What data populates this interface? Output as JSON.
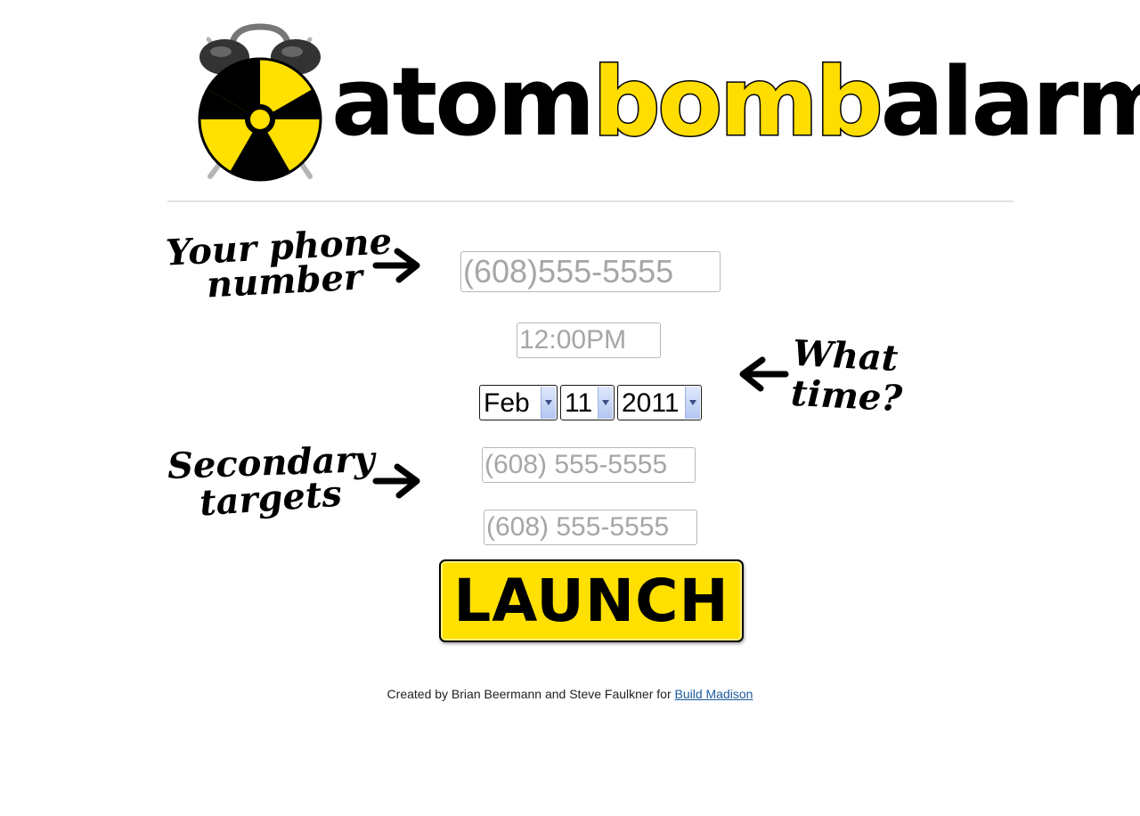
{
  "brand": {
    "word_1": "atom",
    "word_2": "bomb",
    "word_3": "alarm",
    "accent_color": "#ffdd00",
    "icon": "radiation-alarm-clock-icon"
  },
  "annotations": {
    "phone_line_1": "Your phone",
    "phone_line_2": "number",
    "time_line_1": "What",
    "time_line_2": "time?",
    "secondary_line_1": "Secondary",
    "secondary_line_2": "targets"
  },
  "form": {
    "phone": {
      "placeholder": "(608)555-5555",
      "value": ""
    },
    "time": {
      "placeholder": "12:00PM",
      "value": ""
    },
    "date": {
      "month": "Feb",
      "day": "11",
      "year": "2011"
    },
    "secondary_1": {
      "placeholder": "(608) 555-5555",
      "value": ""
    },
    "secondary_2": {
      "placeholder": "(608) 555-5555",
      "value": ""
    },
    "launch_label": "LAUNCH"
  },
  "footer": {
    "text": "Created by Brian Beermann and Steve Faulkner for ",
    "link_text": "Build Madison"
  }
}
